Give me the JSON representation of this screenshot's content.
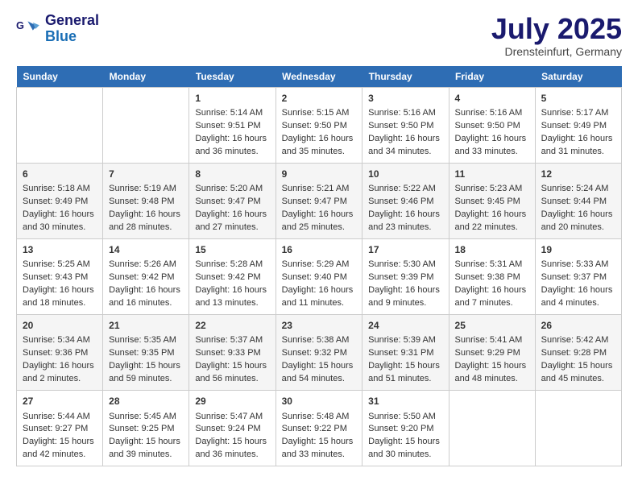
{
  "logo": {
    "line1": "General",
    "line2": "Blue"
  },
  "title": "July 2025",
  "location": "Drensteinfurt, Germany",
  "days_of_week": [
    "Sunday",
    "Monday",
    "Tuesday",
    "Wednesday",
    "Thursday",
    "Friday",
    "Saturday"
  ],
  "weeks": [
    [
      {
        "day": "",
        "sunrise": "",
        "sunset": "",
        "daylight": ""
      },
      {
        "day": "",
        "sunrise": "",
        "sunset": "",
        "daylight": ""
      },
      {
        "day": "1",
        "sunrise": "Sunrise: 5:14 AM",
        "sunset": "Sunset: 9:51 PM",
        "daylight": "Daylight: 16 hours and 36 minutes."
      },
      {
        "day": "2",
        "sunrise": "Sunrise: 5:15 AM",
        "sunset": "Sunset: 9:50 PM",
        "daylight": "Daylight: 16 hours and 35 minutes."
      },
      {
        "day": "3",
        "sunrise": "Sunrise: 5:16 AM",
        "sunset": "Sunset: 9:50 PM",
        "daylight": "Daylight: 16 hours and 34 minutes."
      },
      {
        "day": "4",
        "sunrise": "Sunrise: 5:16 AM",
        "sunset": "Sunset: 9:50 PM",
        "daylight": "Daylight: 16 hours and 33 minutes."
      },
      {
        "day": "5",
        "sunrise": "Sunrise: 5:17 AM",
        "sunset": "Sunset: 9:49 PM",
        "daylight": "Daylight: 16 hours and 31 minutes."
      }
    ],
    [
      {
        "day": "6",
        "sunrise": "Sunrise: 5:18 AM",
        "sunset": "Sunset: 9:49 PM",
        "daylight": "Daylight: 16 hours and 30 minutes."
      },
      {
        "day": "7",
        "sunrise": "Sunrise: 5:19 AM",
        "sunset": "Sunset: 9:48 PM",
        "daylight": "Daylight: 16 hours and 28 minutes."
      },
      {
        "day": "8",
        "sunrise": "Sunrise: 5:20 AM",
        "sunset": "Sunset: 9:47 PM",
        "daylight": "Daylight: 16 hours and 27 minutes."
      },
      {
        "day": "9",
        "sunrise": "Sunrise: 5:21 AM",
        "sunset": "Sunset: 9:47 PM",
        "daylight": "Daylight: 16 hours and 25 minutes."
      },
      {
        "day": "10",
        "sunrise": "Sunrise: 5:22 AM",
        "sunset": "Sunset: 9:46 PM",
        "daylight": "Daylight: 16 hours and 23 minutes."
      },
      {
        "day": "11",
        "sunrise": "Sunrise: 5:23 AM",
        "sunset": "Sunset: 9:45 PM",
        "daylight": "Daylight: 16 hours and 22 minutes."
      },
      {
        "day": "12",
        "sunrise": "Sunrise: 5:24 AM",
        "sunset": "Sunset: 9:44 PM",
        "daylight": "Daylight: 16 hours and 20 minutes."
      }
    ],
    [
      {
        "day": "13",
        "sunrise": "Sunrise: 5:25 AM",
        "sunset": "Sunset: 9:43 PM",
        "daylight": "Daylight: 16 hours and 18 minutes."
      },
      {
        "day": "14",
        "sunrise": "Sunrise: 5:26 AM",
        "sunset": "Sunset: 9:42 PM",
        "daylight": "Daylight: 16 hours and 16 minutes."
      },
      {
        "day": "15",
        "sunrise": "Sunrise: 5:28 AM",
        "sunset": "Sunset: 9:42 PM",
        "daylight": "Daylight: 16 hours and 13 minutes."
      },
      {
        "day": "16",
        "sunrise": "Sunrise: 5:29 AM",
        "sunset": "Sunset: 9:40 PM",
        "daylight": "Daylight: 16 hours and 11 minutes."
      },
      {
        "day": "17",
        "sunrise": "Sunrise: 5:30 AM",
        "sunset": "Sunset: 9:39 PM",
        "daylight": "Daylight: 16 hours and 9 minutes."
      },
      {
        "day": "18",
        "sunrise": "Sunrise: 5:31 AM",
        "sunset": "Sunset: 9:38 PM",
        "daylight": "Daylight: 16 hours and 7 minutes."
      },
      {
        "day": "19",
        "sunrise": "Sunrise: 5:33 AM",
        "sunset": "Sunset: 9:37 PM",
        "daylight": "Daylight: 16 hours and 4 minutes."
      }
    ],
    [
      {
        "day": "20",
        "sunrise": "Sunrise: 5:34 AM",
        "sunset": "Sunset: 9:36 PM",
        "daylight": "Daylight: 16 hours and 2 minutes."
      },
      {
        "day": "21",
        "sunrise": "Sunrise: 5:35 AM",
        "sunset": "Sunset: 9:35 PM",
        "daylight": "Daylight: 15 hours and 59 minutes."
      },
      {
        "day": "22",
        "sunrise": "Sunrise: 5:37 AM",
        "sunset": "Sunset: 9:33 PM",
        "daylight": "Daylight: 15 hours and 56 minutes."
      },
      {
        "day": "23",
        "sunrise": "Sunrise: 5:38 AM",
        "sunset": "Sunset: 9:32 PM",
        "daylight": "Daylight: 15 hours and 54 minutes."
      },
      {
        "day": "24",
        "sunrise": "Sunrise: 5:39 AM",
        "sunset": "Sunset: 9:31 PM",
        "daylight": "Daylight: 15 hours and 51 minutes."
      },
      {
        "day": "25",
        "sunrise": "Sunrise: 5:41 AM",
        "sunset": "Sunset: 9:29 PM",
        "daylight": "Daylight: 15 hours and 48 minutes."
      },
      {
        "day": "26",
        "sunrise": "Sunrise: 5:42 AM",
        "sunset": "Sunset: 9:28 PM",
        "daylight": "Daylight: 15 hours and 45 minutes."
      }
    ],
    [
      {
        "day": "27",
        "sunrise": "Sunrise: 5:44 AM",
        "sunset": "Sunset: 9:27 PM",
        "daylight": "Daylight: 15 hours and 42 minutes."
      },
      {
        "day": "28",
        "sunrise": "Sunrise: 5:45 AM",
        "sunset": "Sunset: 9:25 PM",
        "daylight": "Daylight: 15 hours and 39 minutes."
      },
      {
        "day": "29",
        "sunrise": "Sunrise: 5:47 AM",
        "sunset": "Sunset: 9:24 PM",
        "daylight": "Daylight: 15 hours and 36 minutes."
      },
      {
        "day": "30",
        "sunrise": "Sunrise: 5:48 AM",
        "sunset": "Sunset: 9:22 PM",
        "daylight": "Daylight: 15 hours and 33 minutes."
      },
      {
        "day": "31",
        "sunrise": "Sunrise: 5:50 AM",
        "sunset": "Sunset: 9:20 PM",
        "daylight": "Daylight: 15 hours and 30 minutes."
      },
      {
        "day": "",
        "sunrise": "",
        "sunset": "",
        "daylight": ""
      },
      {
        "day": "",
        "sunrise": "",
        "sunset": "",
        "daylight": ""
      }
    ]
  ]
}
